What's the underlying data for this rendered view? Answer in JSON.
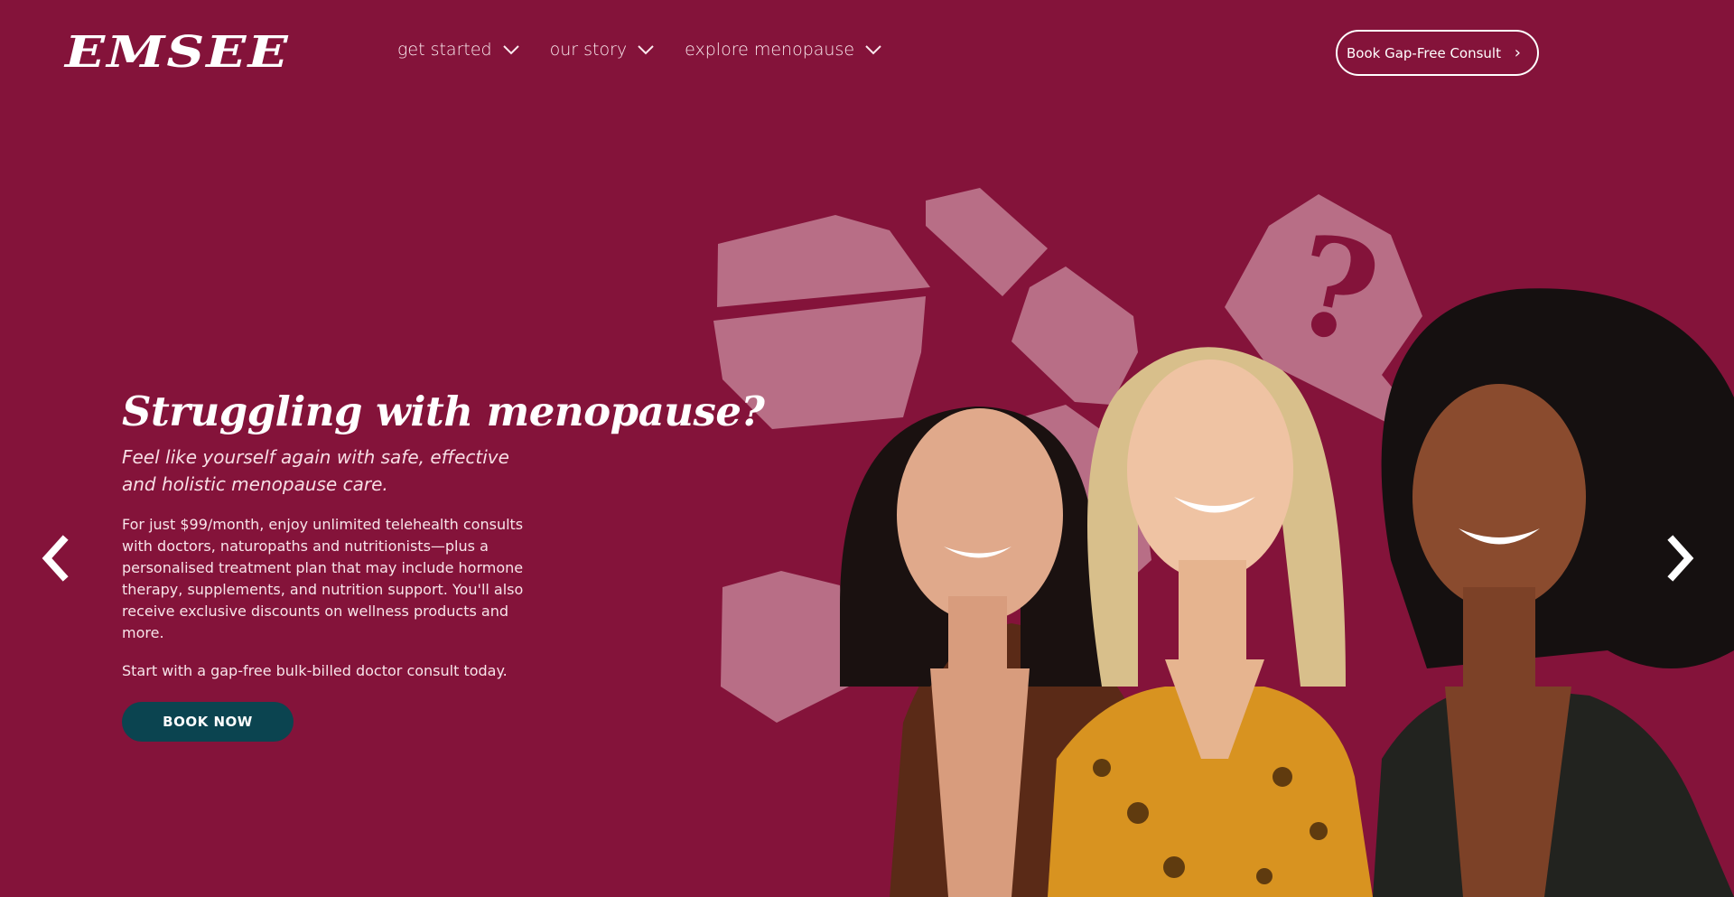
{
  "header": {
    "logo_text": "EMSEE",
    "nav": [
      {
        "label": "get started",
        "icon": "chevron-down-icon"
      },
      {
        "label": "our story",
        "icon": "chevron-down-icon"
      },
      {
        "label": "explore menopause",
        "icon": "chevron-down-icon"
      }
    ],
    "cta_label": "Book Gap-Free Consult",
    "cta_icon": "chevron-right-icon"
  },
  "hero": {
    "headline": "Struggling with menopause?",
    "subhead": "Feel like yourself again with safe, effective and holistic menopause care.",
    "body": "For just $99/month, enjoy unlimited telehealth consults with doctors, naturopaths and nutritionists—plus a personalised treatment plan that may include hormone therapy, supplements, and nutrition support. You'll also receive exclusive discounts on wellness products and more.",
    "cta_line": "Start with a gap-free bulk-billed doctor consult today.",
    "button_label": "BOOK NOW"
  },
  "carousel": {
    "prev_icon": "chevron-left-icon",
    "next_icon": "chevron-right-icon"
  },
  "colors": {
    "background": "#84133a",
    "shape": "#b86e86",
    "button": "#0b4450",
    "text": "#ffffff"
  }
}
